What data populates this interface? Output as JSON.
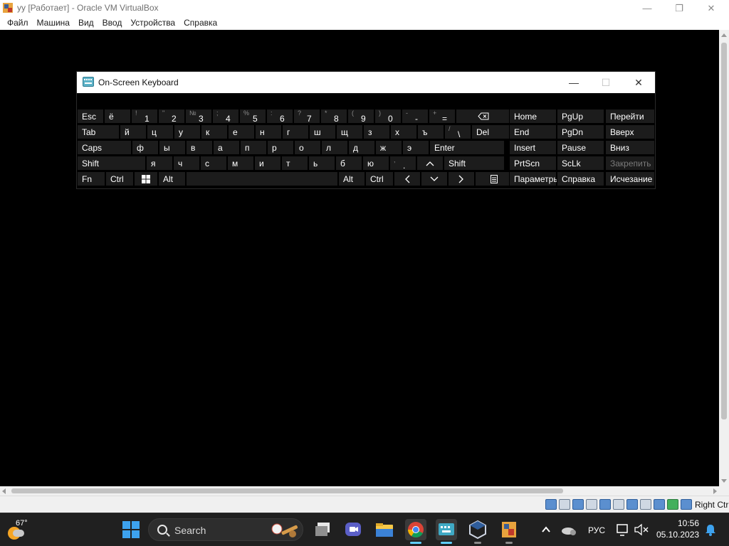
{
  "window": {
    "title": "уу [Работает] - Oracle VM VirtualBox",
    "controls": {
      "minimize": "—",
      "maximize": "❐",
      "close": "✕"
    }
  },
  "menu": [
    "Файл",
    "Машина",
    "Вид",
    "Ввод",
    "Устройства",
    "Справка"
  ],
  "osk": {
    "title": "On-Screen Keyboard",
    "controls": {
      "minimize": "—",
      "maximize": "☐",
      "close": "✕"
    },
    "rows": [
      [
        {
          "label": "Esc"
        },
        {
          "label": "ё"
        },
        {
          "sec": "!",
          "pri": "1"
        },
        {
          "sec": "\"",
          "pri": "2"
        },
        {
          "sec": "№",
          "pri": "3"
        },
        {
          "sec": ";",
          "pri": "4"
        },
        {
          "sec": "%",
          "pri": "5"
        },
        {
          "sec": ":",
          "pri": "6"
        },
        {
          "sec": "?",
          "pri": "7"
        },
        {
          "sec": "*",
          "pri": "8"
        },
        {
          "sec": "(",
          "pri": "9"
        },
        {
          "sec": ")",
          "pri": "0"
        },
        {
          "sec": "-",
          "pri": "-"
        },
        {
          "sec": "+",
          "pri": "="
        },
        {
          "icon": "backspace"
        }
      ],
      [
        {
          "label": "Tab"
        },
        {
          "label": "й"
        },
        {
          "label": "ц"
        },
        {
          "label": "у"
        },
        {
          "label": "к"
        },
        {
          "label": "е"
        },
        {
          "label": "н"
        },
        {
          "label": "г"
        },
        {
          "label": "ш"
        },
        {
          "label": "щ"
        },
        {
          "label": "з"
        },
        {
          "label": "х"
        },
        {
          "label": "ъ"
        },
        {
          "sec": "/",
          "pri": "\\"
        },
        {
          "label": "Del"
        }
      ],
      [
        {
          "label": "Caps"
        },
        {
          "label": "ф"
        },
        {
          "label": "ы"
        },
        {
          "label": "в"
        },
        {
          "label": "а"
        },
        {
          "label": "п"
        },
        {
          "label": "р"
        },
        {
          "label": "о"
        },
        {
          "label": "л"
        },
        {
          "label": "д"
        },
        {
          "label": "ж"
        },
        {
          "label": "э"
        },
        {
          "label": "Enter"
        }
      ],
      [
        {
          "label": "Shift"
        },
        {
          "label": "я"
        },
        {
          "label": "ч"
        },
        {
          "label": "с"
        },
        {
          "label": "м"
        },
        {
          "label": "и"
        },
        {
          "label": "т"
        },
        {
          "label": "ь"
        },
        {
          "label": "б"
        },
        {
          "label": "ю"
        },
        {
          "sec": ",",
          "pri": "."
        },
        {
          "icon": "up"
        },
        {
          "label": "Shift"
        }
      ],
      [
        {
          "label": "Fn"
        },
        {
          "label": "Ctrl"
        },
        {
          "icon": "windows"
        },
        {
          "label": "Alt"
        },
        {
          "label": ""
        },
        {
          "label": "Alt"
        },
        {
          "label": "Ctrl"
        },
        {
          "icon": "left"
        },
        {
          "icon": "down"
        },
        {
          "icon": "right"
        },
        {
          "icon": "menu"
        }
      ]
    ],
    "nav": [
      [
        "Home",
        "PgUp"
      ],
      [
        "End",
        "PgDn"
      ],
      [
        "Insert",
        "Pause"
      ],
      [
        "PrtScn",
        "ScLk"
      ],
      [
        "Параметры",
        "Справка"
      ]
    ],
    "side": [
      {
        "label": "Перейти",
        "dim": false
      },
      {
        "label": "Вверх",
        "dim": false
      },
      {
        "label": "Вниз",
        "dim": false
      },
      {
        "label": "Закрепить",
        "dim": true
      },
      {
        "label": "Исчезание",
        "dim": false
      }
    ]
  },
  "statusbar": {
    "host_key": "Right Ctrl"
  },
  "taskbar": {
    "temperature": "67°",
    "search_placeholder": "Search",
    "apps": [
      "start-icon",
      "task-view-icon",
      "meet-icon",
      "file-explorer-icon",
      "chrome-icon",
      "on-screen-keyboard-icon",
      "virtualbox-icon",
      "virtualbox-manager-icon"
    ],
    "language": "РУС",
    "time": "10:56",
    "date": "05.10.2023"
  }
}
